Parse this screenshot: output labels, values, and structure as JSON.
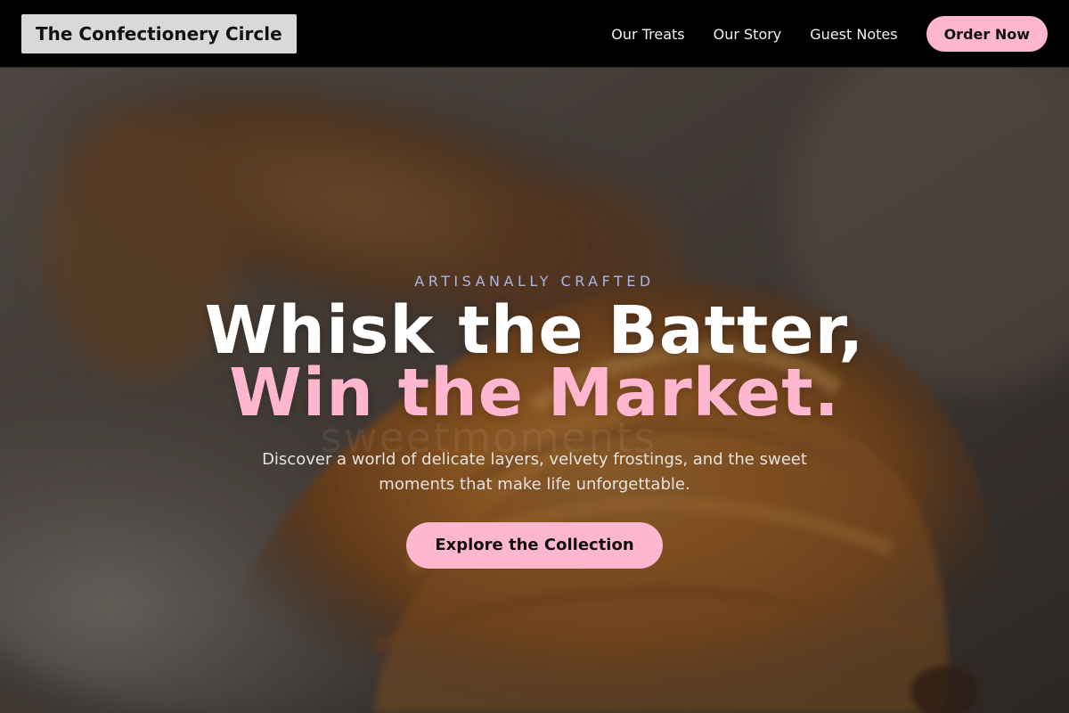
{
  "header": {
    "logo_text": "The Confectionery Circle",
    "nav": [
      {
        "label": "Our Treats"
      },
      {
        "label": "Our Story"
      },
      {
        "label": "Guest Notes"
      }
    ],
    "order_button": "Order Now"
  },
  "hero": {
    "background_image": "croissant-photo",
    "watermark": "sweetmoments",
    "eyebrow": "ARTISANALLY CRAFTED",
    "headline_line1": "Whisk the Batter,",
    "headline_line2": "Win the Market.",
    "subtext": "Discover a world of delicate layers, velvety frostings, and the sweet moments that make life unforgettable.",
    "cta": "Explore the Collection"
  },
  "colors": {
    "accent_pink": "#ffb6cf",
    "eyebrow_blue": "#a9b7e3",
    "header_bg": "#000000",
    "logo_bg": "#d9d9d9"
  }
}
